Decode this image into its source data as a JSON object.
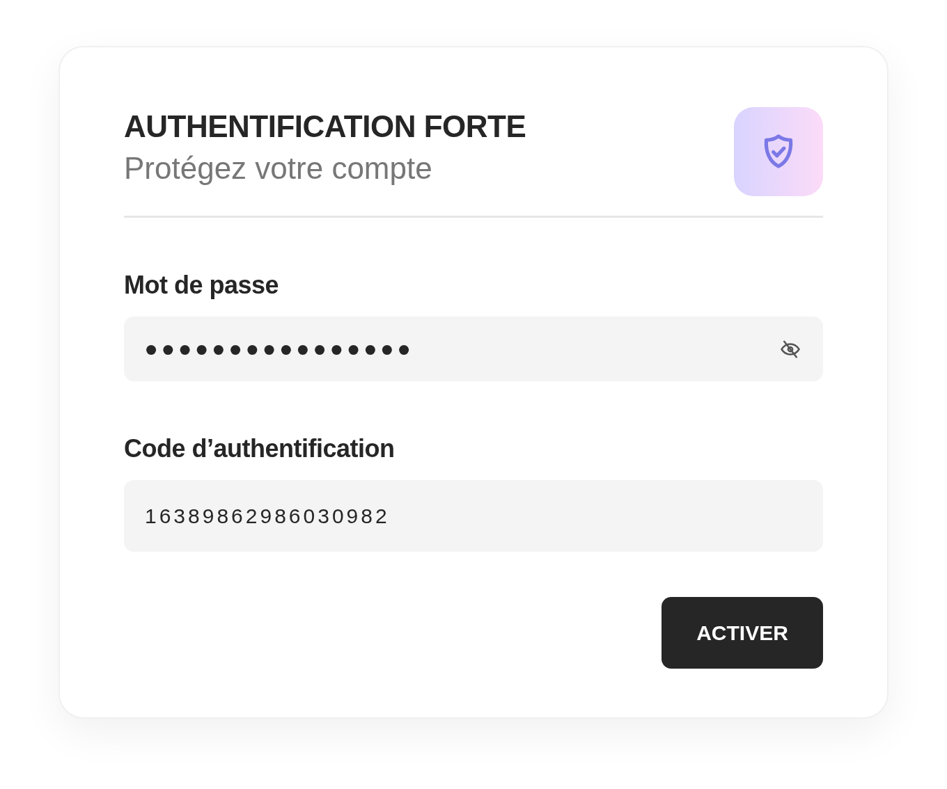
{
  "header": {
    "title": "AUTHENTIFICATION FORTE",
    "subtitle": "Protégez votre compte"
  },
  "fields": [
    {
      "label": "Mot de passe",
      "kind": "password",
      "value": "••••••••••••••••"
    },
    {
      "label": "Code d’authentification",
      "kind": "code",
      "value": "16389862986030982"
    }
  ],
  "buttons": [
    "ACTIVER"
  ]
}
